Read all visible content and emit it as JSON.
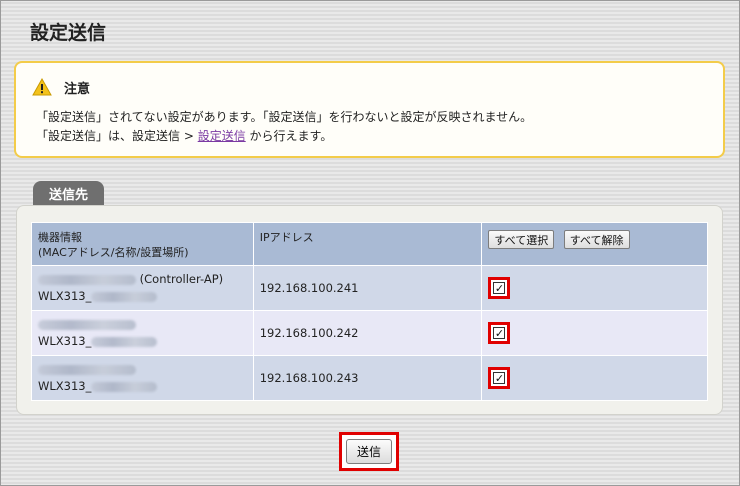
{
  "page": {
    "title": "設定送信"
  },
  "notice": {
    "title": "注意",
    "line1": "「設定送信」されてない設定があります。「設定送信」を行わないと設定が反映されません。",
    "line2_prefix": "「設定送信」は、設定送信 > ",
    "line2_link": "設定送信",
    "line2_suffix": " から行えます。",
    "icon": "warning-icon",
    "accent_color": "#f3cc4a"
  },
  "destinations": {
    "tab_label": "送信先",
    "headers": {
      "device_info_line1": "機器情報",
      "device_info_line2": "(MACアドレス/名称/設置場所)",
      "ip": "IPアドレス",
      "select_all": "すべて選択",
      "clear_all": "すべて解除"
    },
    "rows": [
      {
        "suffix": "(Controller-AP)",
        "model": "WLX313_",
        "ip": "192.168.100.241",
        "checked": true
      },
      {
        "suffix": "",
        "model": "WLX313_",
        "ip": "192.168.100.242",
        "checked": true
      },
      {
        "suffix": "",
        "model": "WLX313_",
        "ip": "192.168.100.243",
        "checked": true
      }
    ]
  },
  "actions": {
    "send_label": "送信"
  },
  "colors": {
    "header_bg": "#a9bad4",
    "highlight": "#e00000"
  }
}
